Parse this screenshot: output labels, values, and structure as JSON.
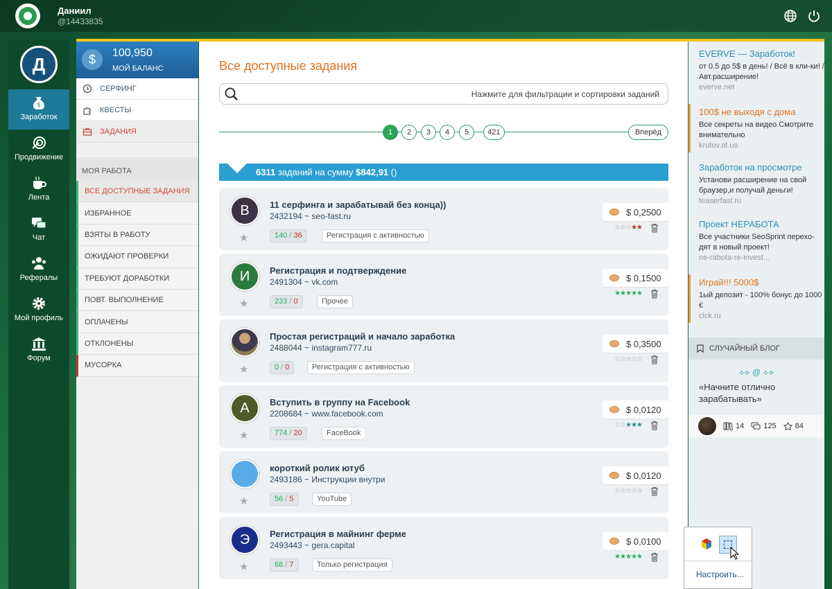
{
  "user": {
    "name": "Даниил",
    "id": "@14433835",
    "avatar_letter": "Д"
  },
  "left_nav": [
    {
      "label": "Заработок",
      "icon": "money-bag-icon",
      "active": true
    },
    {
      "label": "Продвижение",
      "icon": "promotion-target-icon"
    },
    {
      "label": "Лента",
      "icon": "coffee-cup-icon"
    },
    {
      "label": "Чат",
      "icon": "chat-bubbles-icon"
    },
    {
      "label": "Рефералы",
      "icon": "referrals-people-icon"
    },
    {
      "label": "Мой профиль",
      "icon": "gear-icon"
    },
    {
      "label": "Форум",
      "icon": "forum-building-icon"
    }
  ],
  "balance": {
    "amount": "100,950",
    "label": "МОЙ БАЛАНС",
    "symbol": "$"
  },
  "menu_top": [
    {
      "label": "СЕРФИНГ",
      "icon": "clock-icon"
    },
    {
      "label": "КВЕСТЫ",
      "icon": "puzzle-icon"
    },
    {
      "label": "ЗАДАНИЯ",
      "icon": "briefcase-icon",
      "active": true
    }
  ],
  "my_work": {
    "title": "МОЯ РАБОТА",
    "items": [
      {
        "label": "ВСЕ ДОСТУПНЫЕ ЗАДАНИЯ",
        "active": true
      },
      {
        "label": "ИЗБРАННОЕ"
      },
      {
        "label": "ВЗЯТЫ В РАБОТУ"
      },
      {
        "label": "ОЖИДАЮТ ПРОВЕРКИ"
      },
      {
        "label": "ТРЕБУЮТ ДОРАБОТКИ"
      },
      {
        "label": "ПОВТ. ВЫПОЛНЕНИЕ"
      },
      {
        "label": "ОПЛАЧЕНЫ"
      },
      {
        "label": "ОТКЛОНЕНЫ"
      },
      {
        "label": "МУСОРКА"
      }
    ]
  },
  "main": {
    "title": "Все доступные задания",
    "search_text": "Нажмите для фильтрации и сортировки заданий",
    "pages": [
      "1",
      "2",
      "3",
      "4",
      "5",
      "421"
    ],
    "current_page": "1",
    "next_label": "Вперёд",
    "summary_count": "6311",
    "summary_mid": "заданий на сумму",
    "summary_amount": "$842,91",
    "summary_tail": "()"
  },
  "tasks": [
    {
      "avatar": "В",
      "avatar_color": "#3d3344",
      "title": "11 серфинга и зарабатывай без конца))",
      "id": "2432194",
      "site": "seo-fast.ru",
      "done": "140",
      "rejected": "36",
      "category": "Регистрация с активностью",
      "price": "$ 0,2500",
      "rating": "☆☆☆★★",
      "rating_colors": [
        "#999",
        "#999",
        "#999",
        "#c0392b",
        "#c0392b"
      ]
    },
    {
      "avatar": "И",
      "avatar_color": "#2c7a3d",
      "title": "Регистрация и подтверждение",
      "id": "2491304",
      "site": "vk.com",
      "done": "233",
      "rejected": "0",
      "category": "Прочее",
      "price": "$ 0,1500",
      "rating": "★★★★★",
      "rating_colors": [
        "#27ae60",
        "#27ae60",
        "#27ae60",
        "#27ae60",
        "#27ae60"
      ]
    },
    {
      "avatar": "",
      "avatar_color": "#6a6a6a",
      "title": "Простая регистраций и начало заработка",
      "id": "2488044",
      "site": "instagram777.ru",
      "done": "0",
      "rejected": "0",
      "category": "Регистрация с активностью",
      "price": "$ 0,3500",
      "rating": "☆☆☆☆☆",
      "rating_colors": [
        "#999",
        "#999",
        "#999",
        "#999",
        "#999"
      ]
    },
    {
      "avatar": "A",
      "avatar_color": "#4f5a2a",
      "title": "Вступить в группу на Facebook",
      "id": "2208684",
      "site": "www.facebook.com",
      "done": "774",
      "rejected": "20",
      "category": "FaceBook",
      "price": "$ 0,0120",
      "rating": "☆☆★★★",
      "rating_colors": [
        "#999",
        "#999",
        "#2a8a8a",
        "#2a8a8a",
        "#2a8a8a"
      ]
    },
    {
      "avatar": "",
      "avatar_color": "#5aaae8",
      "title": "короткий ролик ютуб",
      "id": "2493186",
      "site": "Инструкции внутри",
      "done": "56",
      "rejected": "5",
      "category": "YouTube",
      "price": "$ 0,0120",
      "rating": "☆☆☆☆☆",
      "rating_colors": [
        "#999",
        "#999",
        "#999",
        "#999",
        "#999"
      ]
    },
    {
      "avatar": "Э",
      "avatar_color": "#1a2d8a",
      "title": "Регистрация в майнинг ферме",
      "id": "2493443",
      "site": "gera.capital",
      "done": "68",
      "rejected": "7",
      "category": "Только регистрация",
      "price": "$ 0,0100",
      "rating": "★★★★★",
      "rating_colors": [
        "#27ae60",
        "#27ae60",
        "#27ae60",
        "#27ae60",
        "#27ae60"
      ]
    }
  ],
  "ads": [
    {
      "title": "EVERVE — Заработок!",
      "desc": "от 0.5 до 5$ в день! / Всё в кли-ки! / Авт.расширение!",
      "url": "everve.net",
      "highlight": false
    },
    {
      "title": "100$ не выходя с дома",
      "desc": "Все секреты на видео.Смотрите внимательно",
      "url": "krutov.at.ua",
      "highlight": true
    },
    {
      "title": "Заработок на просмотре",
      "desc": "Установи расширение на свой браузер,и получай деньги!",
      "url": "teaserfast.ru",
      "highlight": false
    },
    {
      "title": "Проект НЕРАБОТА",
      "desc": "Все участники SeoSprint перехо-дят в новый проект!",
      "url": "ne-rabota-re-invest...",
      "highlight": false
    },
    {
      "title": "Играй!!! 5000$",
      "desc": "1ый депозит - 100% бонус до 1000 €",
      "url": "clck.ru",
      "highlight": true
    }
  ],
  "blog": {
    "header": "СЛУЧАЙНЫЙ БЛОГ",
    "ornament": "⟡⟡ @ ⟡⟡",
    "quote": "«Начните отлично зарабатывать»",
    "books": "14",
    "comments": "125",
    "stars": "84"
  },
  "tray": {
    "configure": "Настроить..."
  }
}
